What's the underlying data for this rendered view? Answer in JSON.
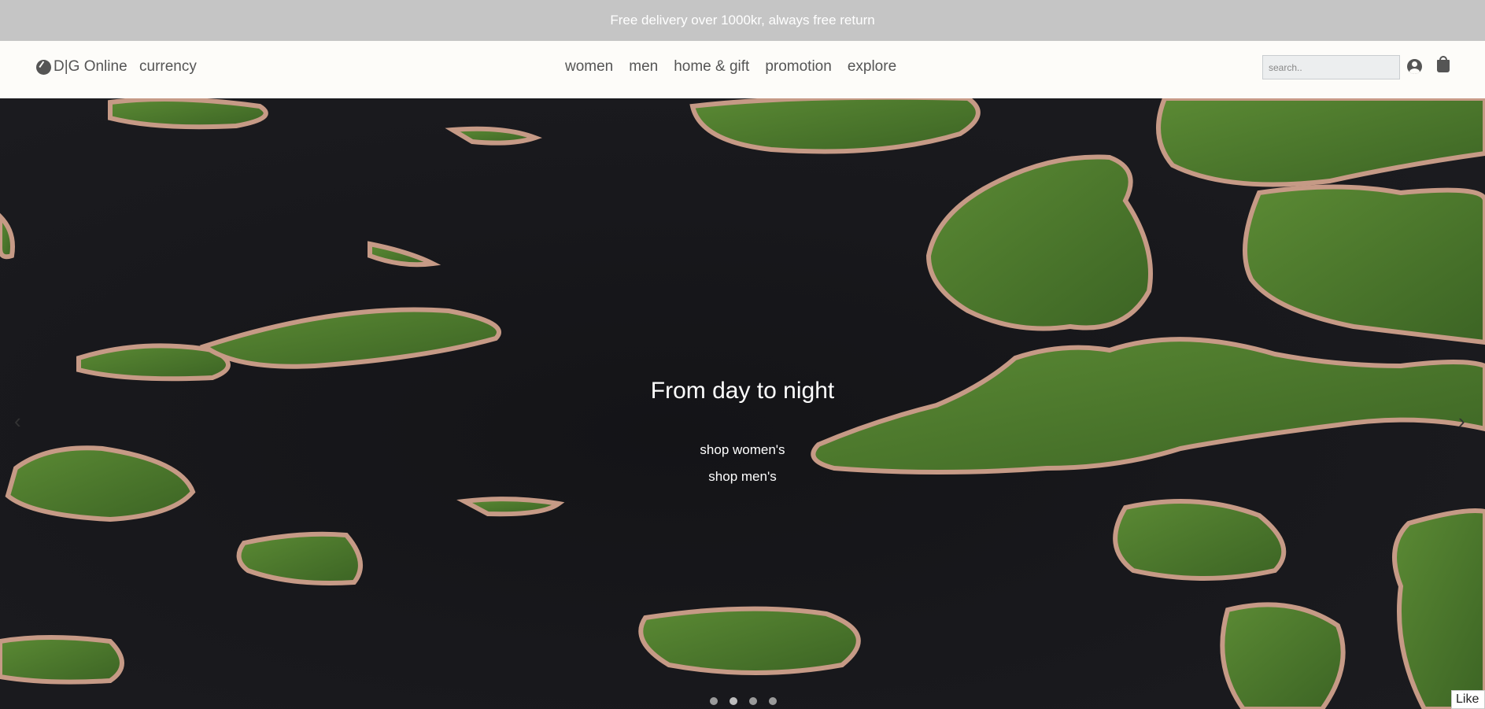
{
  "promo": {
    "text": "Free delivery over 1000kr, always free return"
  },
  "header": {
    "brand": "D|G Online",
    "currency": "currency",
    "nav": [
      "women",
      "men",
      "home & gift",
      "promotion",
      "explore"
    ],
    "search": {
      "placeholder": "search.."
    },
    "icons": [
      "brand-globe-icon",
      "user-icon",
      "shopping-bag-icon"
    ]
  },
  "hero": {
    "title": "From day to night",
    "links": [
      "shop women's",
      "shop men's"
    ],
    "prev_arrow": "‹",
    "next_arrow": "›",
    "slide_count": 4,
    "active_slide": 2
  },
  "like_button": "Like",
  "colors": {
    "promo_bg": "#c5c5c5",
    "nav_bg": "#fdfcf9",
    "nav_text": "#555555",
    "hero_water": "#18181c",
    "island_green": "#4e7a2e",
    "island_shore": "#c69a86"
  }
}
